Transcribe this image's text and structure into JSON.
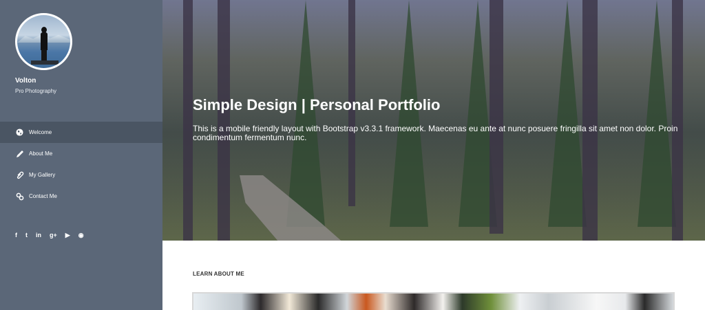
{
  "profile": {
    "name": "Volton",
    "tagline": "Pro Photography"
  },
  "nav": {
    "items": [
      {
        "label": "Welcome",
        "icon": "globe-icon",
        "active": true
      },
      {
        "label": "About Me",
        "icon": "pencil-icon",
        "active": false
      },
      {
        "label": "My Gallery",
        "icon": "paperclip-icon",
        "active": false
      },
      {
        "label": "Contact Me",
        "icon": "link-icon",
        "active": false
      }
    ]
  },
  "social": [
    {
      "glyph": "f",
      "icon": "facebook-icon"
    },
    {
      "glyph": "t",
      "icon": "twitter-icon"
    },
    {
      "glyph": "in",
      "icon": "linkedin-icon"
    },
    {
      "glyph": "g+",
      "icon": "google-plus-icon"
    },
    {
      "glyph": "▶",
      "icon": "youtube-icon"
    },
    {
      "glyph": "◉",
      "icon": "rss-icon"
    }
  ],
  "hero": {
    "title": "Simple Design | Personal Portfolio",
    "text": "This is a mobile friendly layout with Bootstrap v3.3.1 framework. Maecenas eu ante at nunc posuere fringilla sit amet non dolor. Proin condimentum fermentum nunc."
  },
  "section": {
    "heading": "LEARN ABOUT ME"
  },
  "colors": {
    "sidebar": "#5b6778",
    "sidebar_active": "#4a5563"
  }
}
